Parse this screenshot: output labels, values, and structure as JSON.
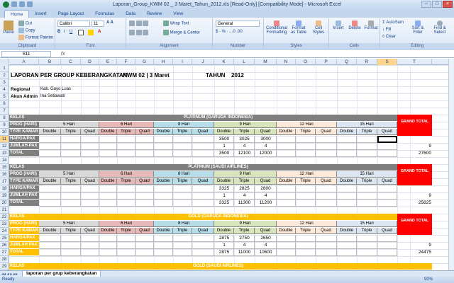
{
  "window": {
    "title": "Laporan_Group_KWM 02 _ 3 Maret_Tahun_2012.xls  [Read-Only]  [Compatibility Mode] - Microsoft Excel"
  },
  "tabs": [
    "Home",
    "Insert",
    "Page Layout",
    "Formulas",
    "Data",
    "Review",
    "View"
  ],
  "ribbon": {
    "paste": "Paste",
    "cut": "Cut",
    "copy": "Copy",
    "format_painter": "Format Painter",
    "clipboard": "Clipboard",
    "font_name": "Calibri",
    "font_size": "11",
    "font_group": "Font",
    "wrap_text": "Wrap Text",
    "merge_center": "Merge & Center",
    "alignment": "Alignment",
    "number_format": "General",
    "number": "Number",
    "cond_format": "Conditional Formatting",
    "format_table": "Format as Table",
    "cell_styles": "Cell Styles",
    "styles": "Styles",
    "insert": "Insert",
    "delete": "Delete",
    "format": "Format",
    "cells": "Cells",
    "autosum": "AutoSum",
    "fill": "Fill",
    "clear": "Clear",
    "sort_filter": "Sort & Filter",
    "find_select": "Find & Select",
    "editing": "Editing"
  },
  "namebox": "S11",
  "fx": "fx",
  "columns": [
    "A",
    "B",
    "C",
    "D",
    "E",
    "F",
    "G",
    "H",
    "I",
    "J",
    "K",
    "L",
    "M",
    "N",
    "O",
    "P",
    "Q",
    "R",
    "S",
    "T"
  ],
  "rows": [
    "1",
    "2",
    "3",
    "4",
    "5",
    "6",
    "7",
    "8",
    "9",
    "10",
    "11",
    "12",
    "13",
    "14",
    "15",
    "16",
    "17",
    "18",
    "19",
    "20",
    "21",
    "22",
    "23",
    "24",
    "25",
    "26",
    "27",
    "28",
    "29",
    "30",
    "31"
  ],
  "header": {
    "title": "LAPORAN PER GROUP KEBERANGKATAN",
    "kwm": "KWM 02 | 3 Maret",
    "tahun_label": "TAHUN",
    "tahun": "2012",
    "regional_label": "Regional",
    "regional": "Kab. Gayo Luas",
    "admin_label": "Akun Admin",
    "admin": "Ina Setiawati"
  },
  "labels": {
    "kelas": "KELAS",
    "prog": "PROG (HARI)",
    "type": "TYPE KAMAR",
    "harga": "HARGA/PAX",
    "jumlah": "JUMLAH PAX",
    "total": "TOTAL",
    "grand": "GRAND TOTAL",
    "days": [
      "5 Hari",
      "6 Hari",
      "8 Hari",
      "9 Hari",
      "12 Hari",
      "15 Hari"
    ],
    "rooms": [
      "Double",
      "Triple",
      "Quad"
    ]
  },
  "colors": {
    "platinum": "#7f7f7f",
    "gold": "#ffc000",
    "d5": "#d9d9d9",
    "d6": "#e6b8b7",
    "d8": "#b7dee8",
    "d9": "#d8e4bc",
    "d12": "#fde9d9",
    "d15": "#dce6f1",
    "grand": "#ff0000"
  },
  "sections": [
    {
      "name": "PLATINUM (GARUDA INDONESIA)",
      "style": "platinum",
      "harga": [
        "3500",
        "3025",
        "3000"
      ],
      "jumlah": [
        "1",
        "4",
        "4"
      ],
      "total": [
        "3500",
        "12100",
        "12000"
      ],
      "grand_jumlah": "9",
      "grand_total": "27600"
    },
    {
      "name": "PLATINUM (SAUDI AIRLINES)",
      "style": "platinum",
      "harga": [
        "3325",
        "2825",
        "2800"
      ],
      "jumlah": [
        "1",
        "4",
        "4"
      ],
      "total": [
        "3325",
        "11300",
        "11200"
      ],
      "grand_jumlah": "9",
      "grand_total": "25825"
    },
    {
      "name": "GOLD (GARUDA INDONESIA)",
      "style": "gold",
      "harga": [
        "2875",
        "2750",
        "2650"
      ],
      "jumlah": [
        "1",
        "4",
        "4"
      ],
      "total": [
        "2875",
        "11000",
        "10600"
      ],
      "grand_jumlah": "9",
      "grand_total": "24475"
    },
    {
      "name": "GOLD (SAUDI AIRLINES)",
      "style": "gold"
    }
  ],
  "sheet_tab": "laporan per grup keberangkatan",
  "status": "Ready",
  "zoom": "90%"
}
